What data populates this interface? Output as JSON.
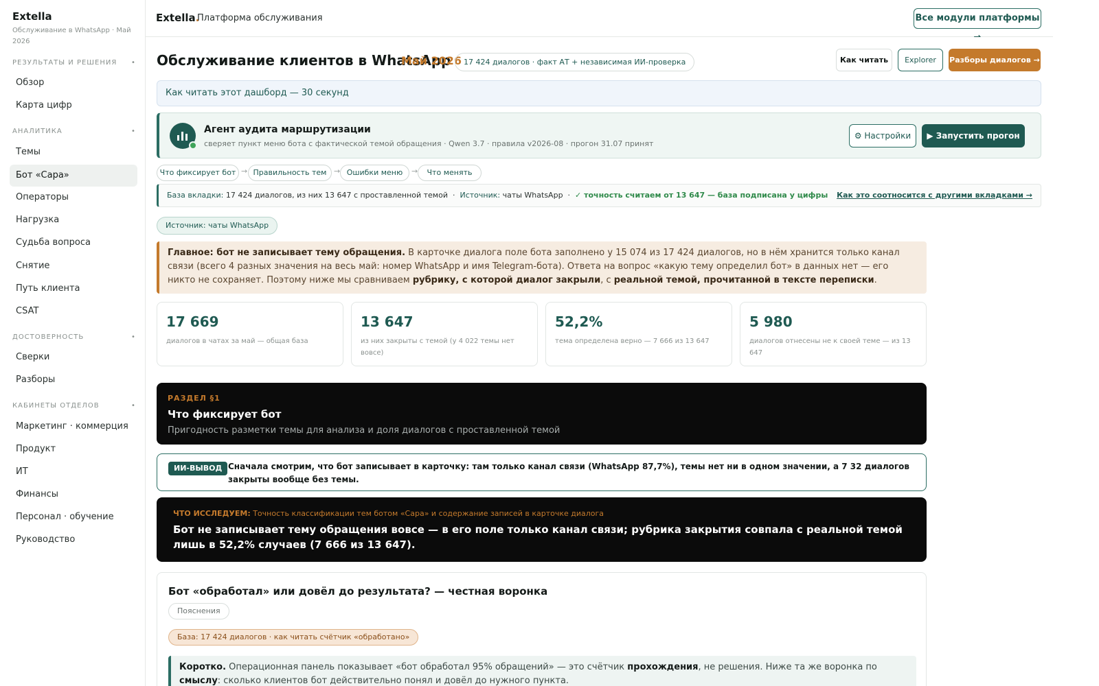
{
  "sidebar": {
    "brand": "Extella",
    "brand_sub": "Обслуживание в WhatsApp · Май 2026",
    "sections": [
      {
        "title": "РЕЗУЛЬТАТЫ И РЕШЕНИЯ",
        "items": [
          "Обзор",
          "Карта цифр"
        ]
      },
      {
        "title": "АНАЛИТИКА",
        "items": [
          "Темы",
          "Бот «Сара»",
          "Операторы",
          "Нагрузка",
          "Судьба вопроса",
          "Снятие",
          "Путь клиента",
          "CSAT"
        ]
      },
      {
        "title": "ДОСТОВЕРНОСТЬ",
        "items": [
          "Сверки",
          "Разборы"
        ]
      },
      {
        "title": "КАБИНЕТЫ ОТДЕЛОВ",
        "items": [
          "Маркетинг · коммерция",
          "Продукт",
          "ИТ",
          "Финансы",
          "Персонал · обучение",
          "Руководство"
        ]
      }
    ],
    "active_item": "Бот «Сара»",
    "section_dot": "•"
  },
  "topbar": {
    "logo": "Extella",
    "logo_dot": ".",
    "title": "Платформа обслуживания",
    "modules_button": "Все модули платформы →"
  },
  "header": {
    "title": "Обслуживание клиентов в WhatsApp",
    "month": "Май 2026",
    "pill": "17 424 диалогов · факт АТ + независимая ИИ-проверка",
    "how_button": "Как читать",
    "explorer_button": "Explorer",
    "razbory_button": "Разборы диалогов →"
  },
  "howto": "Как читать этот дашборд — 30 секунд",
  "agent": {
    "title": "Агент аудита маршрутизации",
    "subtitle": "сверяет пункт меню бота с фактической темой обращения · Qwen 3.7 · правила v2026-08 · прогон 31.07 принят",
    "settings_button": "⚙ Настройки",
    "run_button": "▶ Запустить прогон",
    "status_color": "#3fa45a"
  },
  "steps": [
    "Что фиксирует бот",
    "Правильность тем",
    "Ошибки меню",
    "Что менять"
  ],
  "step_arrow": "→",
  "basebar": {
    "base_label": "База вкладки:",
    "base_value": "17 424 диалогов, из них 13 647 с проставленной темой",
    "sep": "·",
    "source_label": "Источник:",
    "source_value": "чаты WhatsApp",
    "ok_text": "✓ точность считаем от 13 647 — база подписана у цифры",
    "link": "Как это соотносится с другими вкладками →"
  },
  "source_pill": "Источник: чаты WhatsApp",
  "main_note": {
    "lead": "Главное: бот не записывает тему обращения.",
    "text1": " В карточке диалога поле бота заполнено у 15 074 из 17 424 диалогов, но в нём хранится только канал связи (всего 4 разных значения на весь май: номер WhatsApp и имя Telegram-бота). Ответа на вопрос «какую тему определил бот» в данных нет — его никто не сохраняет. Поэтому ниже мы сравниваем ",
    "bold2": "рубрику, с которой диалог закрыли",
    "text2": ", с ",
    "bold3": "реальной темой, прочитанной в тексте переписки",
    "text3": "."
  },
  "kpis": [
    {
      "value": "17 669",
      "label": "диалогов в чатах за май — общая база"
    },
    {
      "value": "13 647",
      "label": "из них закрыты с темой (у 4 022 темы нет вовсе)"
    },
    {
      "value": "52,2%",
      "label": "тема определена верно — 7 666 из 13 647"
    },
    {
      "value": "5 980",
      "label": "диалогов отнесены не к своей теме — из 13 647"
    }
  ],
  "section1": {
    "tag": "РАЗДЕЛ §1",
    "title": "Что фиксирует бот",
    "subtitle": "Пригодность разметки темы для анализа и доля диалогов с проставленной темой"
  },
  "ai": {
    "badge": "ИИ-ВЫВОД",
    "text": "Сначала смотрим, что бот записывает в карточку: там только канал связи (WhatsApp 87,7%), темы нет ни в одном значении, а 7 32 диалогов закрыты вообще без темы."
  },
  "research": {
    "tag_label": "ЧТО ИССЛЕДУЕМ:",
    "tag_text": " Точность классификации тем ботом «Сара» и содержание записей в карточке диалога",
    "text": "Бот не записывает тему обращения вовсе — в его поле только канал связи; рубрика закрытия совпала с реальной темой лишь в 52,2% случаев (7 666 из 13 647)."
  },
  "funnel": {
    "title": "Бот «обработал» или довёл до результата? — честная воронка",
    "pill": "Пояснения",
    "base": "База: 17 424 диалогов · как читать счётчик «обработано»",
    "short_label": "Коротко.",
    "short_text1": " Операционная панель показывает «бот обработал 95% обращений» — это счётчик ",
    "short_bold1": "прохождения",
    "short_text2": ", не решения. Ниже та же воронка по ",
    "short_bold2": "смыслу",
    "short_text3": ": сколько клиентов бот действительно понял и довёл до нужного пункта."
  },
  "colors": {
    "accent": "#1f5a52",
    "orange": "#c47a2c",
    "dark": "#0b0b0b"
  }
}
